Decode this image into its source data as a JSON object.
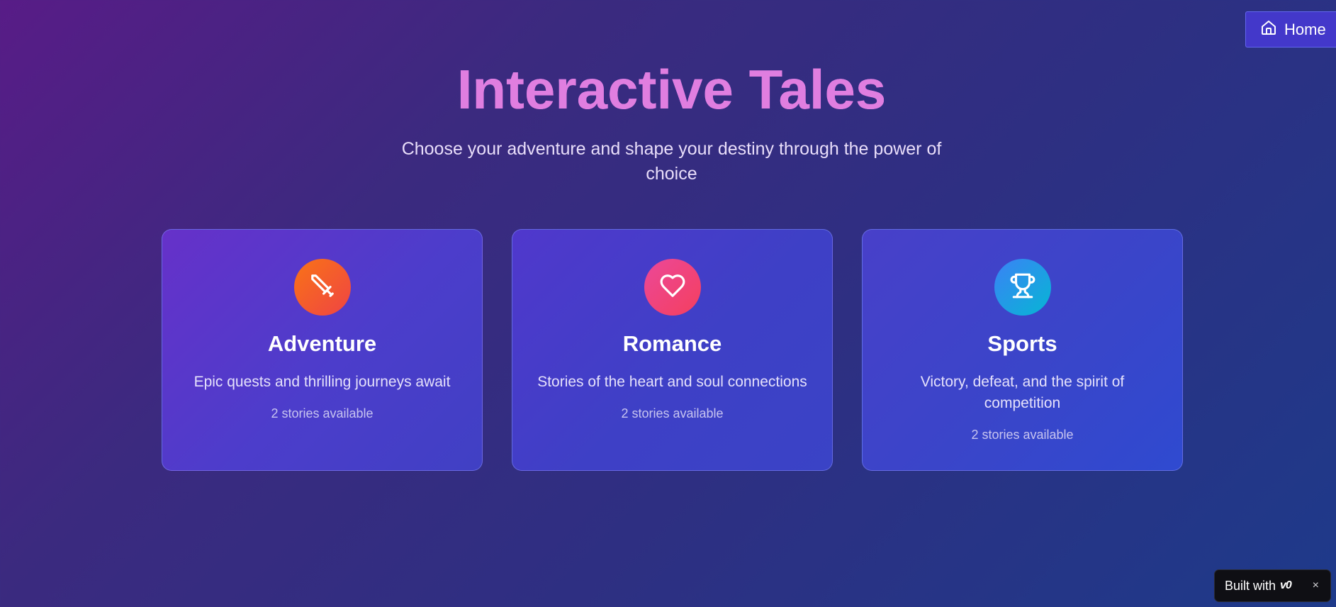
{
  "nav": {
    "home_label": "Home",
    "home_icon": "home-icon"
  },
  "hero": {
    "title": "Interactive Tales",
    "subtitle": "Choose your adventure and shape your destiny through the power of choice"
  },
  "categories": [
    {
      "title": "Adventure",
      "description": "Epic quests and thrilling journeys await",
      "count": "2 stories available",
      "icon": "sword-icon",
      "icon_gradient": [
        "#f97316",
        "#ef4444"
      ]
    },
    {
      "title": "Romance",
      "description": "Stories of the heart and soul connections",
      "count": "2 stories available",
      "icon": "heart-icon",
      "icon_gradient": [
        "#ec4899",
        "#f43f5e"
      ]
    },
    {
      "title": "Sports",
      "description": "Victory, defeat, and the spirit of competition",
      "count": "2 stories available",
      "icon": "trophy-icon",
      "icon_gradient": [
        "#3b82f6",
        "#06b6d4"
      ]
    }
  ],
  "badge": {
    "label": "Built with",
    "logo": "v0",
    "close": "×"
  },
  "colors": {
    "title_accent": "#e07ee0",
    "background_start": "#581c87",
    "background_end": "#1e3a8a",
    "home_button": "#4338ca"
  }
}
